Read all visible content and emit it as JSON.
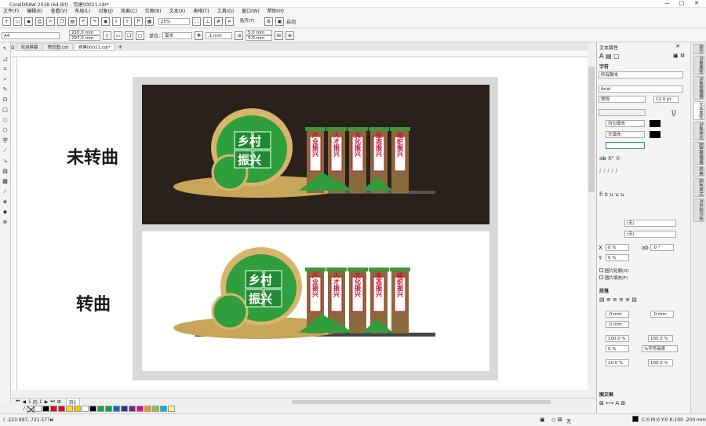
{
  "window": {
    "title": "CorelDRAW 2018 (64-Bit) - 党建00021.cdr*",
    "controls": [
      "—",
      "□",
      "✕"
    ]
  },
  "menu": [
    "文件(F)",
    "编辑(E)",
    "查看(V)",
    "布局(L)",
    "对象(J)",
    "效果(C)",
    "位图(B)",
    "文本(X)",
    "表格(T)",
    "工具(O)",
    "窗口(W)",
    "帮助(H)"
  ],
  "toolbar1": {
    "zoom": "25%",
    "snap": "贴齐(T)",
    "launch": "启动"
  },
  "toolbar2": {
    "page_size": "A4",
    "width": "210.0 mm",
    "height": "297.0 mm",
    "units_label": "单位:",
    "units": "毫米",
    "nudge": ".1 mm",
    "dup_x": "5.0 mm",
    "dup_y": "5.0 mm"
  },
  "tabs": [
    "欢迎屏幕",
    "预览图.cdr",
    "党建00021.cdr*"
  ],
  "canvas": {
    "label_top": "未转曲",
    "label_bottom": "转曲",
    "banner_title_l1": "乡村",
    "banner_title_l2": "振兴",
    "pillars": [
      "产业振兴",
      "人才振兴",
      "文化振兴",
      "生态振兴",
      "组织振兴"
    ]
  },
  "page_nav": {
    "current": "1",
    "of": "的",
    "total": "1",
    "page_tab": "页1"
  },
  "status": {
    "coords": "( -223.997, 721.577 )",
    "fill_none": "无",
    "color_info": "C:0 M:0 Y:0 K:100 .200 mm"
  },
  "panel": {
    "title": "文本属性",
    "section_char": "字符",
    "script": "所有脚本",
    "font": "Arial",
    "style": "常规",
    "size": "12.0 pt",
    "fill_label": "均匀填充",
    "bg_label": "无填充",
    "none1": "(无)",
    "none2": "(无)",
    "x_offset": "0 %",
    "y_offset": "0 %",
    "angle": ".0 °",
    "cb1": "图片轮廓(O)",
    "cb2": "图片填充(F)",
    "section_para": "段落",
    "indent1": ".0 mm",
    "indent2": ".0 mm",
    "indent3": ".0 mm",
    "spacing1": "100.0 %",
    "spacing2": "100.0 %",
    "spacing3": "0 %",
    "spacing_mode": "%字符高度",
    "char_space": "20.0 %",
    "word_space": "100.0 %",
    "section_frame": "图文框"
  },
  "docker_tabs": [
    "提示",
    "对象属性",
    "对象管理器",
    "文本属性",
    "对象样式",
    "图层管理器",
    "转换",
    "颜色样式",
    "对齐和分布"
  ],
  "palette": [
    "#ffffff",
    "#000000",
    "#e30613",
    "#c8102e",
    "#f9d71c",
    "#f5c400",
    "#ffffff",
    "#000000",
    "#1aa538",
    "#00a651",
    "#0072bc",
    "#2e3192",
    "#662d91",
    "#ec008c",
    "#f7941d",
    "#8dc63f",
    "#00aeef",
    "#fff799"
  ]
}
